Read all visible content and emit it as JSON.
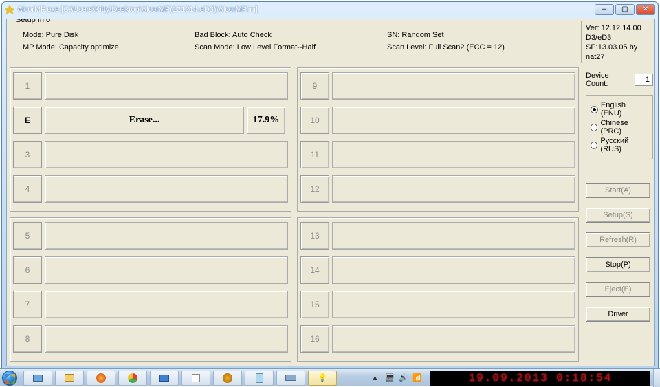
{
  "title": "AlcorMP.exe [C:\\Users\\Kitty\\Desktop\\AlcorMP(121214.eD3)\\AlcorMP.ini]",
  "setup": {
    "legend": "Setup Info",
    "mode": "Mode: Pure Disk",
    "bad_block": "Bad Block: Auto Check",
    "sn": "SN: Random Set",
    "mp_mode": "MP Mode: Capacity optimize",
    "scan_mode": "Scan Mode: Low Level Format--Half",
    "scan_level": "Scan Level: Full Scan2 (ECC = 12)"
  },
  "version": {
    "line1": "Ver: 12.12.14.00",
    "line2": "D3/eD3",
    "line3": "SP:13.03.05 by nat27"
  },
  "device_count": {
    "label": "Device Count:",
    "value": "1"
  },
  "languages": {
    "en": "English (ENU)",
    "cn": "Chinese (PRC)",
    "ru": "Русский (RUS)"
  },
  "buttons": {
    "start": "Start(A)",
    "setup": "Setup(S)",
    "refresh": "Refresh(R)",
    "stop": "Stop(P)",
    "eject": "Eject(E)",
    "driver": "Driver"
  },
  "slots": {
    "s1": "1",
    "s2": "E",
    "s2_status": "Erase...",
    "s2_pct": "17.9%",
    "s3": "3",
    "s4": "4",
    "s5": "5",
    "s6": "6",
    "s7": "7",
    "s8": "8",
    "s9": "9",
    "s10": "10",
    "s11": "11",
    "s12": "12",
    "s13": "13",
    "s14": "14",
    "s15": "15",
    "s16": "16"
  },
  "taskbar": {
    "clock": "19.09.2013   0:18:54"
  }
}
